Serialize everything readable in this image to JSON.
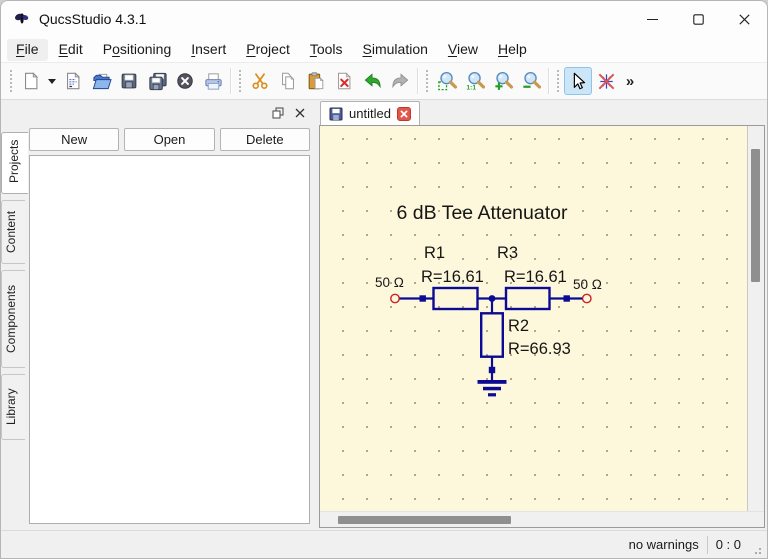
{
  "window": {
    "title": "QucsStudio 4.3.1"
  },
  "titlebar": {
    "controls": [
      "minimize",
      "maximize",
      "close"
    ]
  },
  "menubar": {
    "items": [
      {
        "pre": "",
        "key": "F",
        "post": "ile"
      },
      {
        "pre": "",
        "key": "E",
        "post": "dit"
      },
      {
        "pre": "P",
        "key": "o",
        "post": "sitioning"
      },
      {
        "pre": "",
        "key": "I",
        "post": "nsert"
      },
      {
        "pre": "",
        "key": "P",
        "post": "roject"
      },
      {
        "pre": "",
        "key": "T",
        "post": "ools"
      },
      {
        "pre": "",
        "key": "S",
        "post": "imulation"
      },
      {
        "pre": "",
        "key": "V",
        "post": "iew"
      },
      {
        "pre": "",
        "key": "H",
        "post": "elp"
      }
    ]
  },
  "toolbar": {
    "icons": [
      "new-file",
      "new-file-dropdown",
      "new-text-document",
      "open-file",
      "save",
      "save-all",
      "close-document",
      "print",
      "cut",
      "copy",
      "paste",
      "delete",
      "undo",
      "redo",
      "zoom-fit",
      "zoom-1-1",
      "zoom-in",
      "zoom-out",
      "select",
      "deactivate",
      "overflow"
    ],
    "active_tool": "select",
    "zoom_ratio_label": "1:1",
    "overflow_label": "»"
  },
  "dock": {
    "buttons": {
      "new": "New",
      "open": "Open",
      "delete": "Delete"
    },
    "tabs": [
      "Projects",
      "Content",
      "Components",
      "Library"
    ],
    "active_tab": "Projects"
  },
  "document": {
    "tab_label": "untitled"
  },
  "schematic": {
    "title": "6 dB Tee Attenuator",
    "components": [
      {
        "name": "R1",
        "value": "R=16.61"
      },
      {
        "name": "R3",
        "value": "R=16.61"
      },
      {
        "name": "R2",
        "value": "R=66.93"
      }
    ],
    "ports": {
      "left": "50 Ω",
      "right": "50 Ω"
    }
  },
  "statusbar": {
    "message": "no warnings",
    "cursor_position": "0 : 0"
  },
  "colors": {
    "canvas_bg": "#fdf8dc",
    "wire": "#0b0b94",
    "port": "#cc2222",
    "selection_bg": "#cde6f7",
    "selection_border": "#90c3ea",
    "tab_close": "#e2574c"
  }
}
